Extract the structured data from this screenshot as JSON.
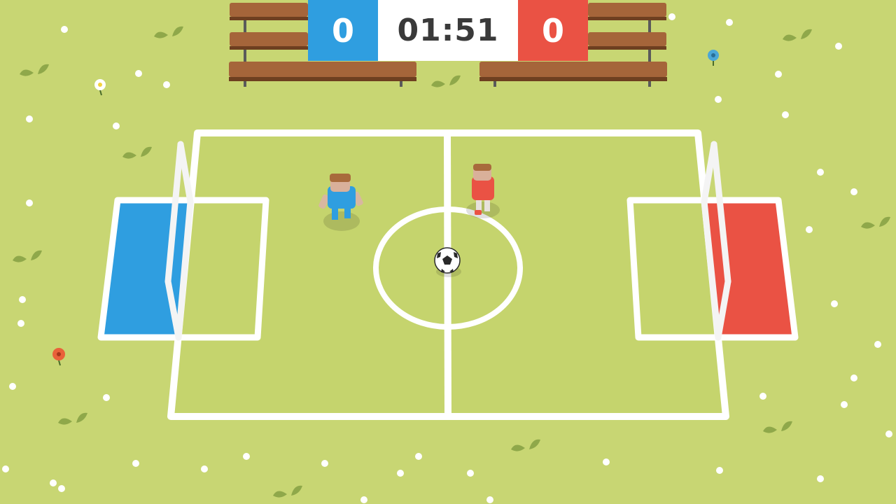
{
  "hud": {
    "blue_score": "0",
    "timer": "01:51",
    "red_score": "0"
  },
  "colors": {
    "grass": "#c8d673",
    "pitch": "#c5d46d",
    "line": "#ffffff",
    "blue_team": "#2f9ee0",
    "red_team": "#ea5244",
    "bench_wood": "#a5653a"
  },
  "icons": {
    "ball": "soccer-ball-icon",
    "flower": "flower-icon",
    "leaf": "leaf-icon"
  }
}
